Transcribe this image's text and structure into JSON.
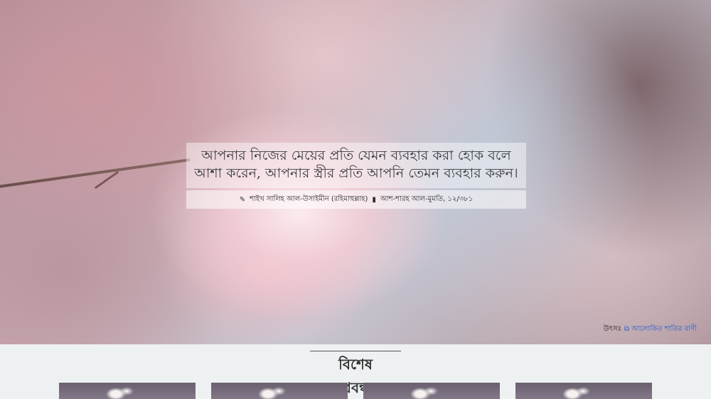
{
  "hero": {
    "quote": "আপনার নিজের মেয়ের প্রতি যেমন ব্যবহার করা হোক বলে আশা করেন, আপনার স্ত্রীর প্রতি আপনি তেমন ব্যবহার করুন।",
    "author": "শাইখ সালিহ আল-উসাইমীন (রহিমাহুল্লাহ)",
    "book": "আশ-শারহ আল-মুমতি, ১২/৩৮১",
    "source_label": "উৎসঃ",
    "source_link": "আলোকিত শাতির বাণী"
  },
  "section": {
    "title": "বিশেষ প্রবন্ধ"
  },
  "cards": [
    {
      "name": "card-1"
    },
    {
      "name": "card-2"
    },
    {
      "name": "card-3"
    },
    {
      "name": "card-4"
    }
  ],
  "icons": {
    "author": "pencil-icon",
    "book": "book-icon",
    "source": "external-link-icon"
  },
  "colors": {
    "link": "#2f62c8",
    "page_background": "#eef1f2"
  }
}
